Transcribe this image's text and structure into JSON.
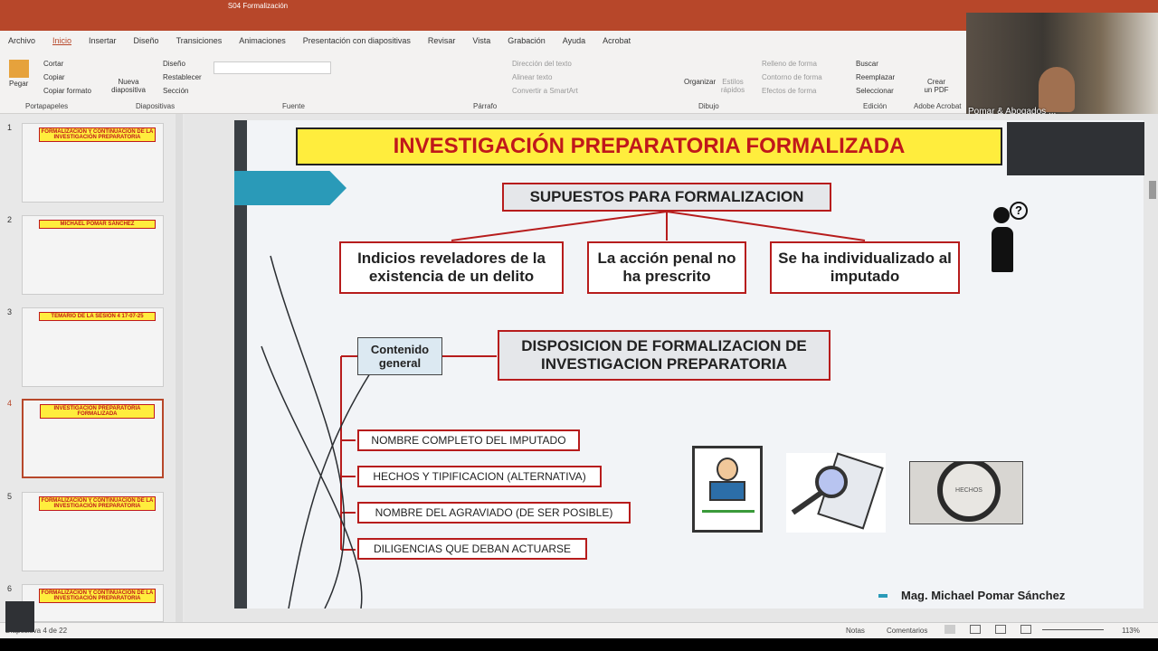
{
  "window": {
    "title": "S04 Formalización"
  },
  "ribbon_tabs": [
    "Archivo",
    "Inicio",
    "Insertar",
    "Diseño",
    "Transiciones",
    "Animaciones",
    "Presentación con diapositivas",
    "Revisar",
    "Vista",
    "Grabación",
    "Ayuda",
    "Acrobat"
  ],
  "ribbon": {
    "portapapeles": {
      "pegar": "Pegar",
      "cortar": "Cortar",
      "copiar": "Copiar",
      "copiar_formato": "Copiar formato",
      "label": "Portapapeles"
    },
    "diapositivas": {
      "nueva": "Nueva diapositiva",
      "diseno": "Diseño",
      "restablecer": "Restablecer",
      "seccion": "Sección",
      "label": "Diapositivas"
    },
    "fuente": {
      "label": "Fuente"
    },
    "parrafo": {
      "direccion": "Dirección del texto",
      "alinear": "Alinear texto",
      "convertir": "Convertir a SmartArt",
      "label": "Párrafo"
    },
    "dibujo": {
      "organizar": "Organizar",
      "estilos": "Estilos rápidos",
      "relleno": "Relleno de forma",
      "contorno": "Contorno de forma",
      "efectos": "Efectos de forma",
      "label": "Dibujo"
    },
    "edicion": {
      "buscar": "Buscar",
      "reemplazar": "Reemplazar",
      "seleccionar": "Seleccionar",
      "label": "Edición"
    },
    "acrobat": {
      "crear": "Crear un PDF",
      "label": "Adobe Acrobat"
    }
  },
  "video": {
    "name": "Pomar & Abogados ..."
  },
  "thumbnails": [
    {
      "num": "1",
      "title": "FORMALIZACIÓN Y CONTINUACIÓN DE LA INVESTIGACIÓN PREPARATORIA"
    },
    {
      "num": "2",
      "title": "MICHAEL POMAR SÁNCHEZ"
    },
    {
      "num": "3",
      "title": "TEMARIO DE LA SESIÓN 4 17-07-25"
    },
    {
      "num": "4",
      "title": "INVESTIGACIÓN PREPARATORIA FORMALIZADA"
    },
    {
      "num": "5",
      "title": "FORMALIZACIÓN Y CONTINUACIÓN DE LA INVESTIGACIÓN PREPARATORIA"
    },
    {
      "num": "6",
      "title": "FORMALIZACIÓN Y CONTINUACIÓN DE LA INVESTIGACIÓN PREPARATORIA"
    }
  ],
  "slide": {
    "title": "INVESTIGACIÓN PREPARATORIA FORMALIZADA",
    "supuestos": "SUPUESTOS PARA FORMALIZACION",
    "sup1": "Indicios reveladores de la existencia de un delito",
    "sup2": "La acción penal no ha prescrito",
    "sup3": "Se ha individualizado al imputado",
    "contenido": "Contenido general",
    "disposicion": "DISPOSICION DE FORMALIZACION DE INVESTIGACION PREPARATORIA",
    "items": [
      "NOMBRE COMPLETO DEL IMPUTADO",
      "HECHOS Y TIPIFICACION (ALTERNATIVA)",
      "NOMBRE DEL AGRAVIADO (DE SER POSIBLE)",
      "DILIGENCIAS QUE DEBAN ACTUARSE"
    ],
    "hechos": "HECHOS",
    "author": "Mag. Michael Pomar Sánchez"
  },
  "status": {
    "slide": "Diapositiva 4 de 22",
    "notas": "Notas",
    "comentarios": "Comentarios",
    "zoom": "113%"
  }
}
